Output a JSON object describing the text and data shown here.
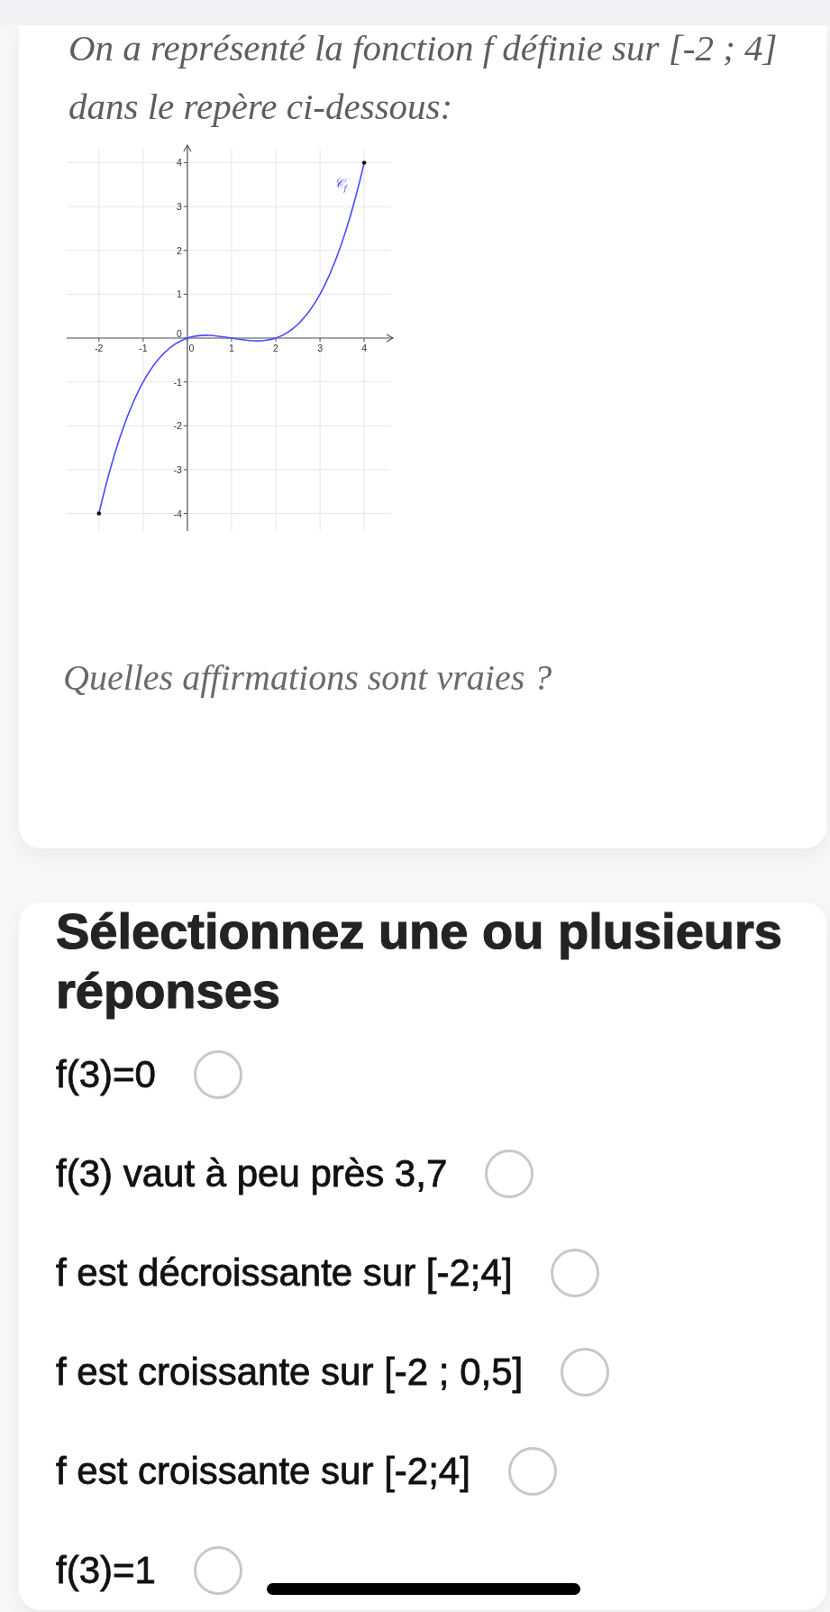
{
  "question_card": {
    "intro": "On a représenté la fonction f définie sur [-2 ; 4] dans le repère ci-dessous:",
    "chart_data": {
      "type": "line",
      "x": [
        -2,
        -1,
        0,
        1,
        2,
        3,
        4
      ],
      "series": [
        {
          "name": "𝒞$_{f}$",
          "color": "#4b4bff",
          "values": [
            -4,
            -1,
            0,
            0,
            0,
            1,
            4
          ]
        }
      ],
      "xlim": [
        -2.73,
        4.65
      ],
      "ylim": [
        -4.4,
        4.4
      ],
      "xticks": [
        -2,
        -1,
        0,
        1,
        2,
        3,
        4
      ],
      "yticks": [
        -4,
        -3,
        -2,
        -1,
        0,
        1,
        2,
        3,
        4
      ],
      "grid": true
    },
    "prompt": "Quelles affirmations sont vraies ?"
  },
  "answer_card": {
    "title": "Sélectionnez une ou plusieurs réponses",
    "options": [
      {
        "label": "f(3)=0",
        "checked": false
      },
      {
        "label": "f(3) vaut à peu près 3,7",
        "checked": false
      },
      {
        "label": "f est décroissante sur [-2;4]",
        "checked": false
      },
      {
        "label": "f est croissante sur [-2 ; 0,5]",
        "checked": false
      },
      {
        "label": "f est croissante sur [-2;4]",
        "checked": false
      },
      {
        "label": "f(3)=1",
        "checked": false
      }
    ]
  }
}
